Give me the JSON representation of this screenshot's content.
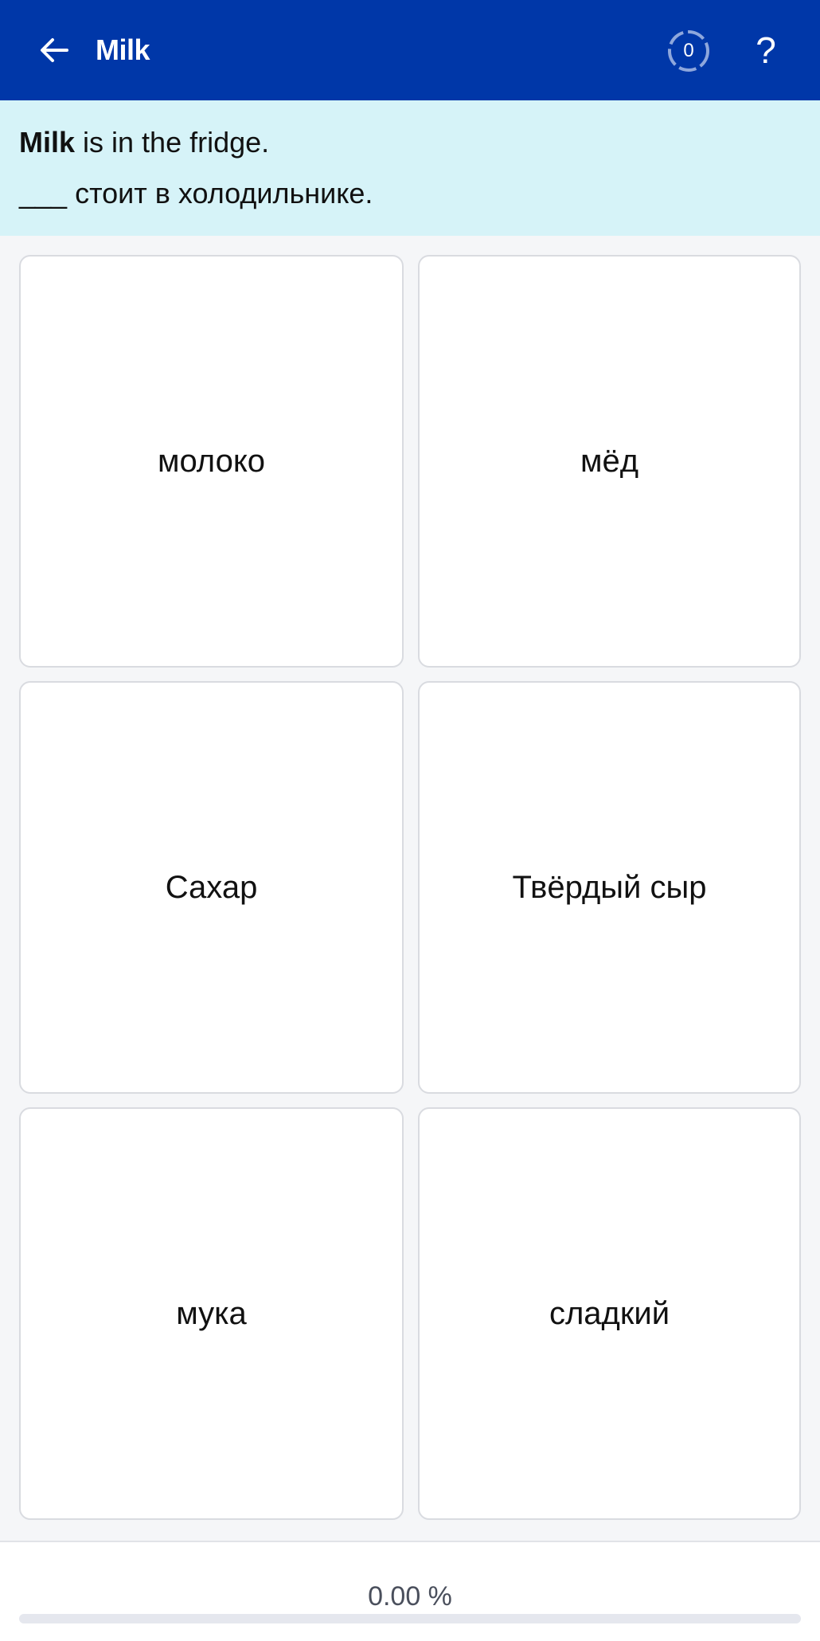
{
  "header": {
    "back_icon": "arrow-left-icon",
    "title": "Milk",
    "counter": "0",
    "help_label": "?"
  },
  "prompt": {
    "target_word": "Milk",
    "sentence_rest": " is in the fridge.",
    "blank": "___",
    "translation": " стоит в холодильнике."
  },
  "options": [
    {
      "label": "молоко"
    },
    {
      "label": "мёд"
    },
    {
      "label": "Сахар"
    },
    {
      "label": "Твёрдый сыр"
    },
    {
      "label": "мука"
    },
    {
      "label": "сладкий"
    }
  ],
  "footer": {
    "progress_text": "0.00 %",
    "progress_value": 0
  },
  "colors": {
    "header_bg": "#0037a8",
    "prompt_bg": "#d6f3f8",
    "page_bg": "#f5f6f8"
  }
}
